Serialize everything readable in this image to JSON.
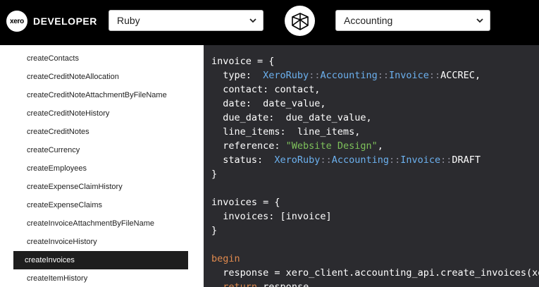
{
  "header": {
    "logo_mark": "xero",
    "logo_text": "DEVELOPER",
    "language_select": {
      "value": "Ruby",
      "icon": "chevron-down-icon"
    },
    "api_select": {
      "value": "Accounting",
      "icon": "chevron-down-icon"
    },
    "language_icon": "ruby-gem-icon"
  },
  "sidebar": {
    "items": [
      {
        "label": "createContacts",
        "active": false
      },
      {
        "label": "createCreditNoteAllocation",
        "active": false
      },
      {
        "label": "createCreditNoteAttachmentByFileName",
        "active": false
      },
      {
        "label": "createCreditNoteHistory",
        "active": false
      },
      {
        "label": "createCreditNotes",
        "active": false
      },
      {
        "label": "createCurrency",
        "active": false
      },
      {
        "label": "createEmployees",
        "active": false
      },
      {
        "label": "createExpenseClaimHistory",
        "active": false
      },
      {
        "label": "createExpenseClaims",
        "active": false
      },
      {
        "label": "createInvoiceAttachmentByFileName",
        "active": false
      },
      {
        "label": "createInvoiceHistory",
        "active": false
      },
      {
        "label": "createInvoices",
        "active": true
      },
      {
        "label": "createItemHistory",
        "active": false
      }
    ]
  },
  "code": {
    "lines": [
      [
        {
          "t": "invoice = {",
          "c": ""
        }
      ],
      [
        {
          "t": "  type:  ",
          "c": ""
        },
        {
          "t": "XeroRuby",
          "c": "blue"
        },
        {
          "t": "::",
          "c": "grey"
        },
        {
          "t": "Accounting",
          "c": "blue"
        },
        {
          "t": "::",
          "c": "grey"
        },
        {
          "t": "Invoice",
          "c": "blue"
        },
        {
          "t": "::",
          "c": "grey"
        },
        {
          "t": "ACCREC,",
          "c": ""
        }
      ],
      [
        {
          "t": "  contact: contact,",
          "c": ""
        }
      ],
      [
        {
          "t": "  date:  date_value,",
          "c": ""
        }
      ],
      [
        {
          "t": "  due_date:  due_date_value,",
          "c": ""
        }
      ],
      [
        {
          "t": "  line_items:  line_items,",
          "c": ""
        }
      ],
      [
        {
          "t": "  reference: ",
          "c": ""
        },
        {
          "t": "\"Website Design\"",
          "c": "green"
        },
        {
          "t": ",",
          "c": ""
        }
      ],
      [
        {
          "t": "  status:  ",
          "c": ""
        },
        {
          "t": "XeroRuby",
          "c": "blue"
        },
        {
          "t": "::",
          "c": "grey"
        },
        {
          "t": "Accounting",
          "c": "blue"
        },
        {
          "t": "::",
          "c": "grey"
        },
        {
          "t": "Invoice",
          "c": "blue"
        },
        {
          "t": "::",
          "c": "grey"
        },
        {
          "t": "DRAFT",
          "c": ""
        }
      ],
      [
        {
          "t": "}",
          "c": ""
        }
      ],
      [
        {
          "t": "",
          "c": ""
        }
      ],
      [
        {
          "t": "invoices = {",
          "c": ""
        }
      ],
      [
        {
          "t": "  invoices: [invoice]",
          "c": ""
        }
      ],
      [
        {
          "t": "}",
          "c": ""
        }
      ],
      [
        {
          "t": "",
          "c": ""
        }
      ],
      [
        {
          "t": "begin",
          "c": "orange"
        }
      ],
      [
        {
          "t": "  response = xero_client.accounting_api.create_invoices(xero_tenant_id, invoices)",
          "c": ""
        }
      ],
      [
        {
          "t": "  ",
          "c": ""
        },
        {
          "t": "return",
          "c": "orange"
        },
        {
          "t": " response",
          "c": ""
        }
      ]
    ]
  },
  "colors": {
    "topbar": "#000000",
    "code_bg": "#2b2b2f",
    "code_text": "#ffffff",
    "constant": "#6cb1ef",
    "string": "#7ec15b",
    "keyword": "#e08a4e",
    "active_item_bg": "#1e1e1e"
  }
}
